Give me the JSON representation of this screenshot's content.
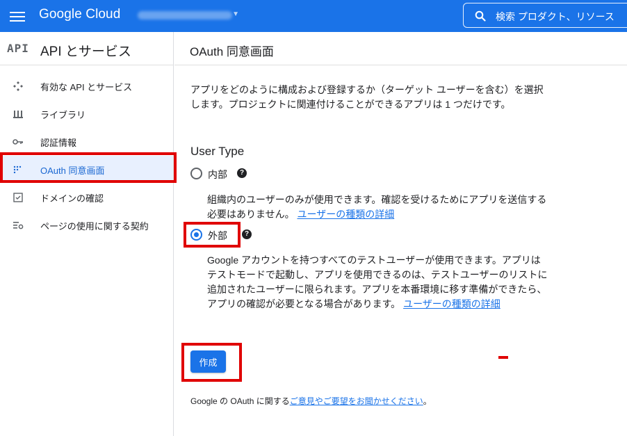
{
  "header": {
    "logo": "Google Cloud",
    "project_name": "My Project 00000",
    "search_placeholder": "検索  プロダクト、リソース"
  },
  "sidebar": {
    "glyph": "API",
    "title": "API とサービス",
    "items": [
      {
        "label": "有効な API とサービス",
        "icon": "api-hub-icon"
      },
      {
        "label": "ライブラリ",
        "icon": "library-icon"
      },
      {
        "label": "認証情報",
        "icon": "key-icon"
      },
      {
        "label": "OAuth 同意画面",
        "icon": "consent-icon",
        "active": true
      },
      {
        "label": "ドメインの確認",
        "icon": "checkbox-icon"
      },
      {
        "label": "ページの使用に関する契約",
        "icon": "settings-list-icon"
      }
    ]
  },
  "main": {
    "title": "OAuth 同意画面",
    "intro": "アプリをどのように構成および登録するか（ターゲット ユーザーを含む）を選択します。プロジェクトに関連付けることができるアプリは 1 つだけです。",
    "user_type_label": "User Type",
    "internal": {
      "label": "内部",
      "checked": false,
      "desc": "組織内のユーザーのみが使用できます。確認を受けるためにアプリを送信する必要はありません。",
      "link": "ユーザーの種類の詳細"
    },
    "external": {
      "label": "外部",
      "checked": true,
      "desc": "Google アカウントを持つすべてのテストユーザーが使用できます。アプリはテストモードで起動し、アプリを使用できるのは、テストユーザーのリストに追加されたユーザーに限られます。アプリを本番環境に移す準備ができたら、アプリの確認が必要となる場合があります。",
      "link": "ユーザーの種類の詳細"
    },
    "create_button": "作成",
    "footer_prefix": "Google の OAuth に関する",
    "footer_link": "ご意見やご要望をお聞かせください",
    "footer_suffix": "。"
  },
  "colors": {
    "brand": "#1a73e8",
    "highlight": "#e00000"
  }
}
